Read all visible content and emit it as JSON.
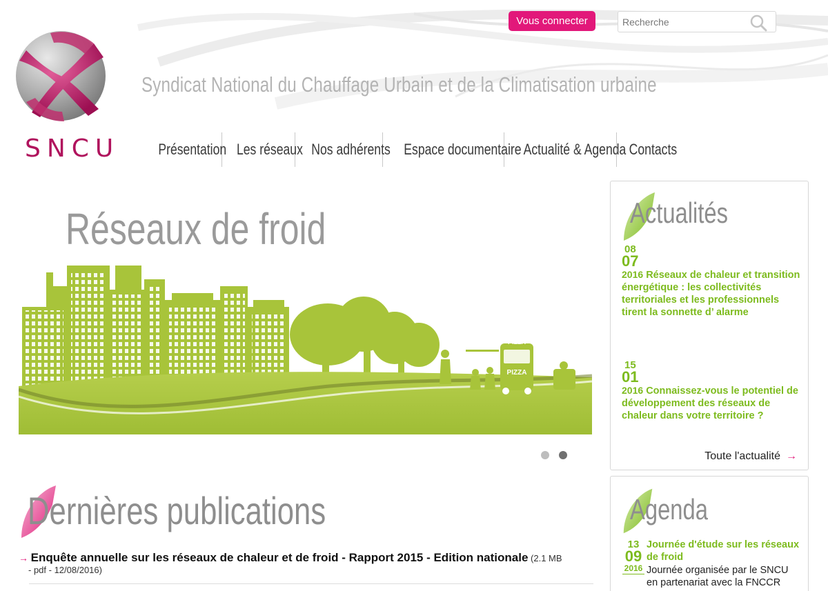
{
  "header": {
    "logo_text": "SNCU",
    "site_title": "Syndicat National du Chauffage Urbain et de la Climatisation urbaine",
    "login_label": "Vous connecter",
    "search_placeholder": "Recherche",
    "brand_color": "#e2187a",
    "logo_color": "#b0135d"
  },
  "nav": {
    "items": [
      {
        "label": "Présentation"
      },
      {
        "label": "Les réseaux"
      },
      {
        "label": "Nos adhérents"
      },
      {
        "label": "Espace documentaire"
      },
      {
        "label": "Actualité & Agenda"
      },
      {
        "label": "Contacts"
      }
    ]
  },
  "hero": {
    "title": "Réseaux de froid",
    "bus_sign_top": "PIZZA",
    "bus_sign_front": "PIZZA",
    "slides_total": 2,
    "active_slide": 2,
    "green_color": "#a8c43a"
  },
  "publications": {
    "title": "Dernières publications",
    "items": [
      {
        "title": "Enquête annuelle sur les réseaux de chaleur et de froid - Rapport 2015 - Edition nationale",
        "meta_part1": "(2.1 MB",
        "meta_part2": "- pdf - 12/08/2016)"
      }
    ]
  },
  "news": {
    "title": "Actualités",
    "items": [
      {
        "day": "08",
        "month": "07",
        "year": "2016",
        "text": "Réseaux de chaleur et transition énergétique : les collectivités territoriales et les professionnels tirent la sonnette d’ alarme"
      },
      {
        "day": "15",
        "month": "01",
        "year": "2016",
        "text": "Connaissez-vous le potentiel de développement des réseaux de chaleur dans votre territoire ?"
      }
    ],
    "all_label": "Toute l'actualité",
    "accent_color": "#7dbb1e"
  },
  "agenda": {
    "title": "Agenda",
    "items": [
      {
        "day": "13",
        "month": "09",
        "year": "2016",
        "title": "Journée d'étude sur les réseaux de froid",
        "desc": "Journée organisée par le SNCU en partenariat avec la FNCCR"
      }
    ]
  }
}
